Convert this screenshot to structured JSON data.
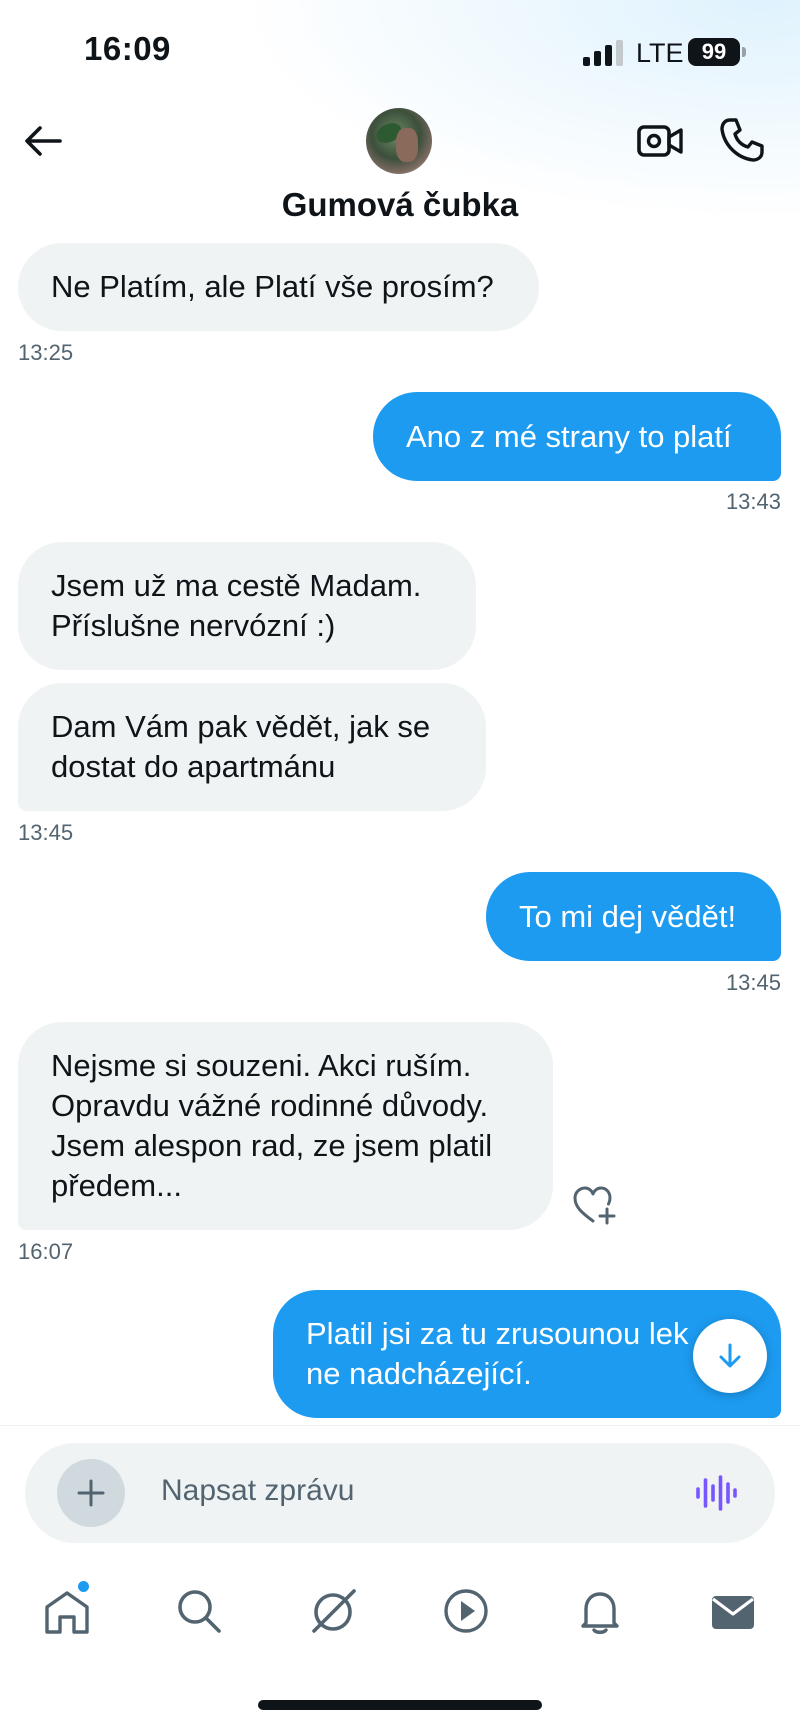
{
  "status_bar": {
    "time": "16:09",
    "network": "LTE",
    "battery": "99"
  },
  "header": {
    "contact_name": "Gumová čubka"
  },
  "messages": [
    {
      "direction": "in",
      "lines": [
        "Ne Platím, ale Platí vše prosím?"
      ],
      "time": "13:25"
    },
    {
      "direction": "out",
      "lines": [
        "Ano z mé strany to platí"
      ],
      "time": "13:43"
    },
    {
      "direction": "in",
      "lines": [
        "Jsem už ma cestě Madam.",
        "Příslušne nervózní :)"
      ]
    },
    {
      "direction": "in",
      "lines": [
        "Dam Vám pak vědět, jak se",
        "dostat do apartmánu"
      ],
      "time": "13:45"
    },
    {
      "direction": "out",
      "lines": [
        "To mi dej vědět!"
      ],
      "time": "13:45"
    },
    {
      "direction": "in",
      "lines": [
        "Nejsme si souzeni. Akci ruším.",
        "Opravdu vážné rodinné důvody.",
        "Jsem alespon rad, ze jsem platil",
        "předem..."
      ],
      "time": "16:07"
    },
    {
      "direction": "out",
      "lines": [
        "Platil jsi za tu zrusounou lek",
        "ne nadcházející."
      ]
    }
  ],
  "composer": {
    "placeholder": "Napsat zprávu"
  },
  "icons": {
    "back": "arrow-left-icon",
    "video": "video-call-icon",
    "phone": "phone-icon",
    "reaction": "heart-plus-icon",
    "scroll": "arrow-down-icon",
    "add": "plus-icon",
    "voice": "voice-wave-icon",
    "tabs": [
      "home-icon",
      "search-icon",
      "grok-icon",
      "video-play-icon",
      "bell-icon",
      "mail-icon"
    ]
  },
  "colors": {
    "accent": "#1d9bf0",
    "incoming_bubble": "#eff3f4",
    "voice": "#7856ff"
  }
}
